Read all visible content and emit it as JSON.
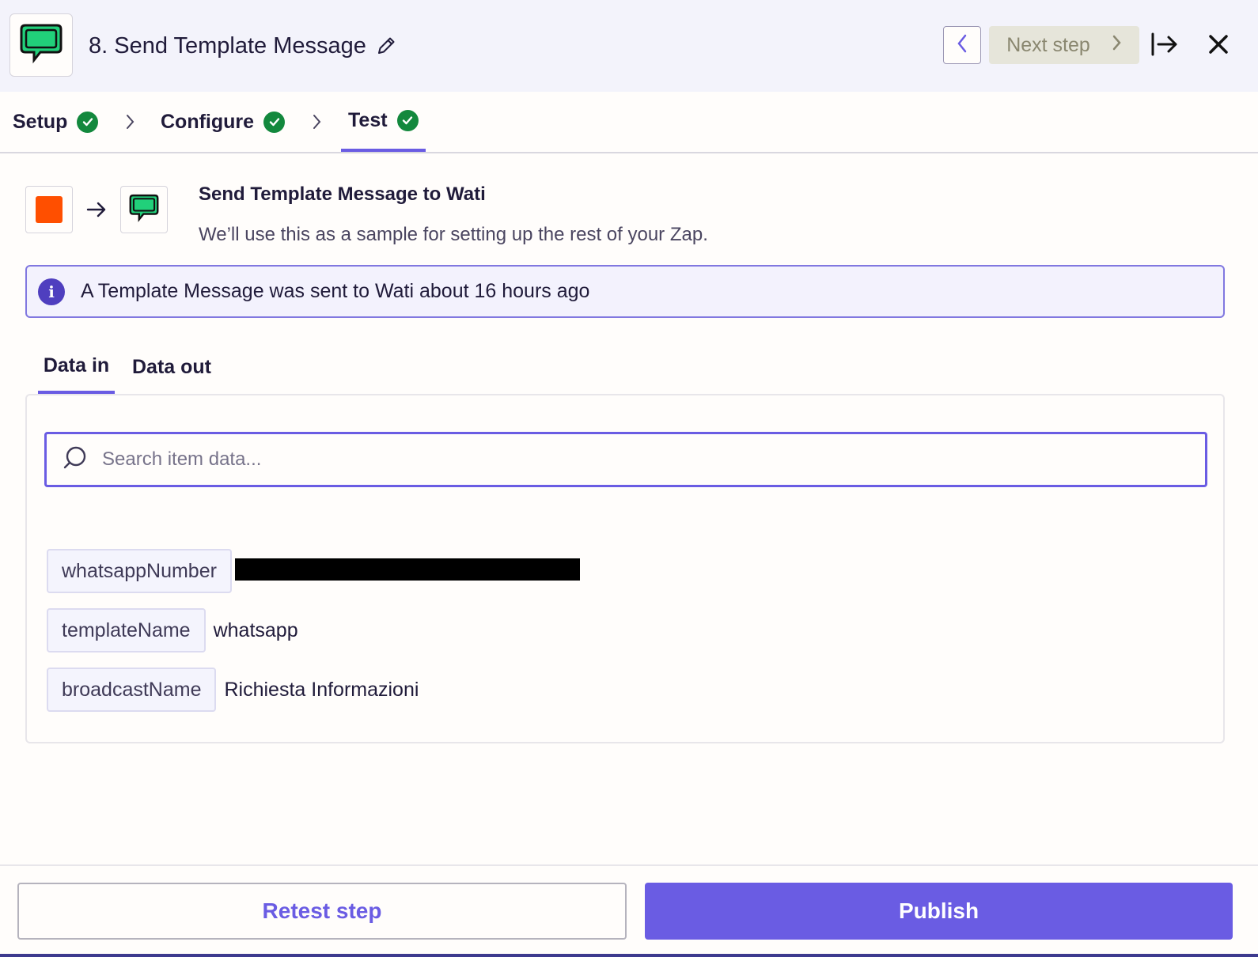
{
  "header": {
    "step_title": "8. Send Template Message",
    "next_step_label": "Next step"
  },
  "stepper": {
    "steps": [
      {
        "label": "Setup",
        "status": "complete"
      },
      {
        "label": "Configure",
        "status": "complete"
      },
      {
        "label": "Test",
        "status": "complete",
        "active": true
      }
    ]
  },
  "summary": {
    "title": "Send Template Message to Wati",
    "subtitle": "We’ll use this as a sample for setting up the rest of your Zap."
  },
  "info_banner": {
    "text": "A Template Message was sent to Wati about 16 hours ago"
  },
  "data_tabs": [
    {
      "label": "Data in",
      "active": true
    },
    {
      "label": "Data out",
      "active": false
    }
  ],
  "search": {
    "placeholder": "Search item data...",
    "value": ""
  },
  "fields": [
    {
      "key": "whatsappNumber",
      "value": "",
      "redacted": true
    },
    {
      "key": "templateName",
      "value": "whatsapp"
    },
    {
      "key": "broadcastName",
      "value": "Richiesta Informazioni"
    }
  ],
  "footer": {
    "retest_label": "Retest step",
    "publish_label": "Publish"
  },
  "colors": {
    "accent": "#6a5ce3",
    "success": "#13883d",
    "trigger_orange": "#ff4f00",
    "wati_green": "#21d07a"
  },
  "icons": [
    "wati-chat-icon",
    "pencil-icon",
    "chevron-left-icon",
    "chevron-right-icon",
    "collapse-panel-icon",
    "close-icon",
    "check-circle-icon",
    "arrow-right-icon",
    "info-icon",
    "search-icon"
  ]
}
